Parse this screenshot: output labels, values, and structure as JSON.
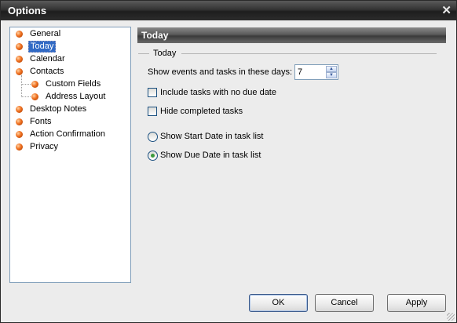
{
  "window": {
    "title": "Options"
  },
  "tree": {
    "items": [
      {
        "label": "General",
        "level": 0
      },
      {
        "label": "Today",
        "level": 0,
        "selected": true
      },
      {
        "label": "Calendar",
        "level": 0
      },
      {
        "label": "Contacts",
        "level": 0
      },
      {
        "label": "Custom Fields",
        "level": 1
      },
      {
        "label": "Address Layout",
        "level": 1
      },
      {
        "label": "Desktop Notes",
        "level": 0
      },
      {
        "label": "Fonts",
        "level": 0
      },
      {
        "label": "Action Confirmation",
        "level": 0
      },
      {
        "label": "Privacy",
        "level": 0
      }
    ]
  },
  "panel": {
    "header": "Today",
    "group_title": "Today",
    "days_label": "Show events and tasks in these days:",
    "days_value": "7",
    "include_no_due_label": "Include tasks with no due date",
    "include_no_due_checked": false,
    "hide_completed_label": "Hide completed tasks",
    "hide_completed_checked": false,
    "radio_start_label": "Show Start Date in task list",
    "radio_due_label": "Show Due Date in task list",
    "selected_radio": "due"
  },
  "buttons": {
    "ok": "OK",
    "cancel": "Cancel",
    "apply": "Apply"
  },
  "colors": {
    "selection": "#316ac5",
    "bullet": "#f07020",
    "radio_dot": "#3c9a3c"
  }
}
